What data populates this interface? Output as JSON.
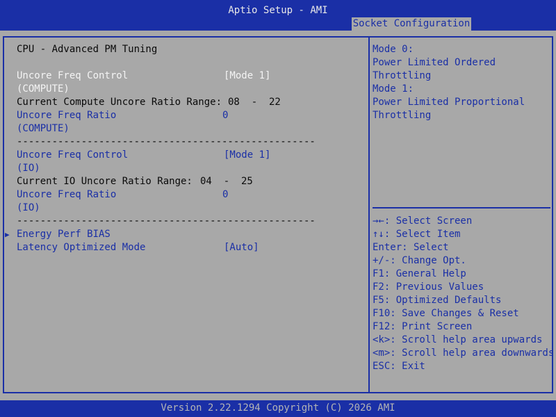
{
  "header": {
    "title": "Aptio Setup - AMI",
    "active_tab": "Socket Configuration"
  },
  "page": {
    "title": "CPU - Advanced PM Tuning",
    "compute": {
      "freq_control_label": "Uncore Freq Control",
      "freq_control_sublabel": "(COMPUTE)",
      "freq_control_value": "[Mode 1]",
      "range_label": "Current Compute Uncore Ratio Range:",
      "range_value": "08  -  22",
      "ratio_label": "Uncore Freq Ratio",
      "ratio_sublabel": "(COMPUTE)",
      "ratio_value": "0"
    },
    "separator": "---------------------------------------------------",
    "io": {
      "freq_control_label": "Uncore Freq Control",
      "freq_control_sublabel": "(IO)",
      "freq_control_value": "[Mode 1]",
      "range_label": "Current IO Uncore Ratio Range:",
      "range_value": "04  -  25",
      "ratio_label": "Uncore Freq Ratio",
      "ratio_sublabel": "(IO)",
      "ratio_value": "0"
    },
    "energy_perf_bias_label": "Energy Perf BIAS",
    "latency_label": "Latency Optimized Mode",
    "latency_value": "[Auto]"
  },
  "help": {
    "lines": [
      "Mode 0:",
      "Power Limited Ordered",
      "Throttling",
      "Mode 1:",
      "Power Limited Proportional",
      "Throttling"
    ]
  },
  "keys": [
    "→←: Select Screen",
    "↑↓: Select Item",
    "Enter: Select",
    "+/-: Change Opt.",
    "F1: General Help",
    "F2: Previous Values",
    "F5: Optimized Defaults",
    "F10: Save Changes & Reset",
    "F12: Print Screen",
    "<k>: Scroll help area upwards",
    "<m>: Scroll help area downwards",
    "ESC: Exit"
  ],
  "footer": {
    "version": "Version 2.22.1294 Copyright (C) 2026 AMI"
  },
  "colors": {
    "background": "#a8a8a8",
    "bar_blue": "#1a2fa6",
    "highlight_text": "#f4f4f4",
    "footer_text": "#b4b4b4"
  },
  "icons": {
    "submenu_marker": "triangle-right-icon"
  }
}
